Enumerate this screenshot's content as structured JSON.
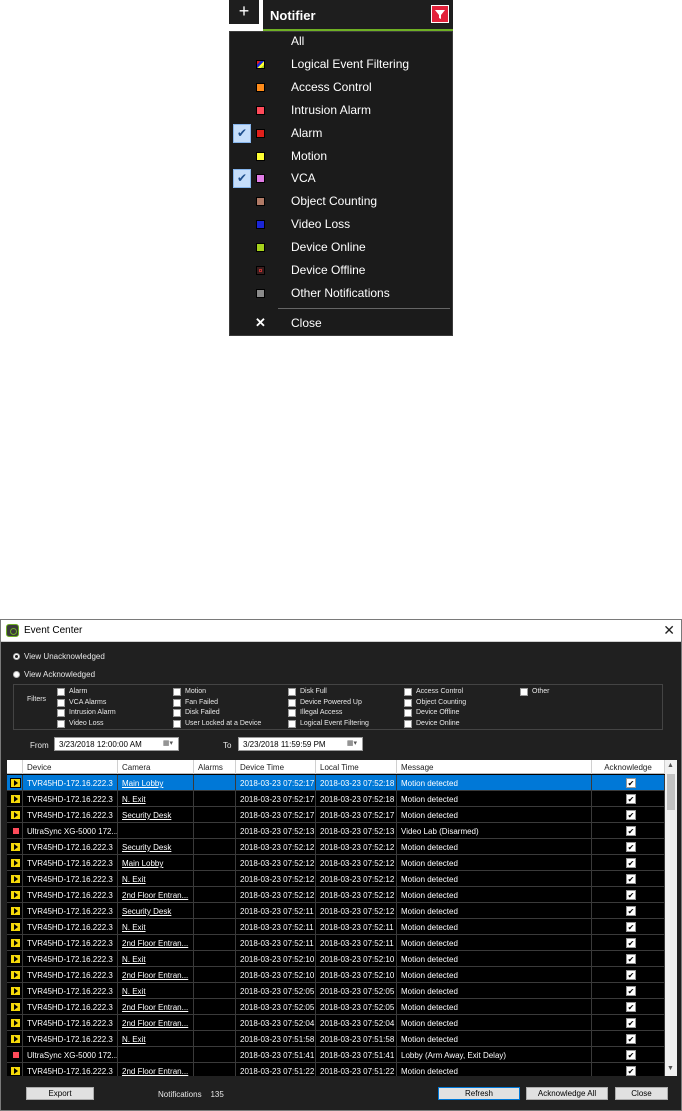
{
  "notifier": {
    "plus_label": "+",
    "title": "Notifier",
    "filter_icon": "filter-funnel-icon",
    "items": [
      {
        "label": "All",
        "color": "",
        "checked": false
      },
      {
        "label": "Logical Event Filtering",
        "color": "multicolor",
        "checked": false
      },
      {
        "label": "Access Control",
        "color": "#ff8c1a",
        "checked": false
      },
      {
        "label": "Intrusion Alarm",
        "color": "#ff4b5a",
        "checked": false
      },
      {
        "label": "Alarm",
        "color": "#e0201b",
        "checked": true
      },
      {
        "label": "Motion",
        "color": "#ffff33",
        "checked": false
      },
      {
        "label": "VCA",
        "color": "#e17ce6",
        "checked": true
      },
      {
        "label": "Object Counting",
        "color": "#b07a66",
        "checked": false
      },
      {
        "label": "Video Loss",
        "color": "#1a25d6",
        "checked": false
      },
      {
        "label": "Device Online",
        "color": "#a6d21c",
        "checked": false
      },
      {
        "label": "Device Offline",
        "color": "#3a1e1e",
        "checked": false
      },
      {
        "label": "Other Notifications",
        "color": "#8a8a8a",
        "checked": false
      }
    ],
    "close_label": "Close",
    "check_mark": "✔"
  },
  "event_center": {
    "title": "Event Center",
    "close_glyph": "✕",
    "view_unacknowledged": "View Unacknowledged",
    "view_acknowledged": "View Acknowledged",
    "filters_label": "Filters",
    "filters": [
      [
        "Alarm",
        "VCA Alarms",
        "Intrusion Alarm",
        "Video Loss"
      ],
      [
        "Motion",
        "Fan Failed",
        "Disk Failed",
        "User Locked at a Device"
      ],
      [
        "Disk Full",
        "Device Powered Up",
        "Illegal Access",
        "Logical Event Filtering"
      ],
      [
        "Access Control",
        "Object Counting",
        "Device Offline",
        "Device Online"
      ],
      [
        "Other"
      ]
    ],
    "from_label": "From",
    "from_value": "3/23/2018 12:00:00 AM",
    "to_label": "To",
    "to_value": "3/23/2018 11:59:59 PM",
    "columns": [
      "Device",
      "Camera",
      "Alarms",
      "Device Time",
      "Local Time",
      "Message",
      "Acknowledge"
    ],
    "rows": [
      {
        "type": "cam",
        "device": "TVR45HD-172.16.222.3",
        "camera": "Main Lobby",
        "alarms": "",
        "device_time": "2018-03-23 07:52:17",
        "local_time": "2018-03-23 07:52:18",
        "message": "Motion detected",
        "ack": true,
        "selected": true
      },
      {
        "type": "cam",
        "device": "TVR45HD-172.16.222.3",
        "camera": "N. Exit",
        "alarms": "",
        "device_time": "2018-03-23 07:52:17",
        "local_time": "2018-03-23 07:52:18",
        "message": "Motion detected",
        "ack": true
      },
      {
        "type": "cam",
        "device": "TVR45HD-172.16.222.3",
        "camera": "Security Desk",
        "alarms": "",
        "device_time": "2018-03-23 07:52:17",
        "local_time": "2018-03-23 07:52:17",
        "message": "Motion detected",
        "ack": true
      },
      {
        "type": "intr",
        "device": "UltraSync XG-5000 172...",
        "camera": "",
        "alarms": "",
        "device_time": "2018-03-23 07:52:13",
        "local_time": "2018-03-23 07:52:13",
        "message": "Video Lab (Disarmed)",
        "ack": true
      },
      {
        "type": "cam",
        "device": "TVR45HD-172.16.222.3",
        "camera": "Security Desk",
        "alarms": "",
        "device_time": "2018-03-23 07:52:12",
        "local_time": "2018-03-23 07:52:12",
        "message": "Motion detected",
        "ack": true
      },
      {
        "type": "cam",
        "device": "TVR45HD-172.16.222.3",
        "camera": "Main Lobby",
        "alarms": "",
        "device_time": "2018-03-23 07:52:12",
        "local_time": "2018-03-23 07:52:12",
        "message": "Motion detected",
        "ack": true
      },
      {
        "type": "cam",
        "device": "TVR45HD-172.16.222.3",
        "camera": "N. Exit",
        "alarms": "",
        "device_time": "2018-03-23 07:52:12",
        "local_time": "2018-03-23 07:52:12",
        "message": "Motion detected",
        "ack": true
      },
      {
        "type": "cam",
        "device": "TVR45HD-172.16.222.3",
        "camera": "2nd Floor Entran...",
        "alarms": "",
        "device_time": "2018-03-23 07:52:12",
        "local_time": "2018-03-23 07:52:12",
        "message": "Motion detected",
        "ack": true
      },
      {
        "type": "cam",
        "device": "TVR45HD-172.16.222.3",
        "camera": "Security Desk",
        "alarms": "",
        "device_time": "2018-03-23 07:52:11",
        "local_time": "2018-03-23 07:52:12",
        "message": "Motion detected",
        "ack": true
      },
      {
        "type": "cam",
        "device": "TVR45HD-172.16.222.3",
        "camera": "N. Exit",
        "alarms": "",
        "device_time": "2018-03-23 07:52:11",
        "local_time": "2018-03-23 07:52:11",
        "message": "Motion detected",
        "ack": true
      },
      {
        "type": "cam",
        "device": "TVR45HD-172.16.222.3",
        "camera": "2nd Floor Entran...",
        "alarms": "",
        "device_time": "2018-03-23 07:52:11",
        "local_time": "2018-03-23 07:52:11",
        "message": "Motion detected",
        "ack": true
      },
      {
        "type": "cam",
        "device": "TVR45HD-172.16.222.3",
        "camera": "N. Exit",
        "alarms": "",
        "device_time": "2018-03-23 07:52:10",
        "local_time": "2018-03-23 07:52:10",
        "message": "Motion detected",
        "ack": true
      },
      {
        "type": "cam",
        "device": "TVR45HD-172.16.222.3",
        "camera": "2nd Floor Entran...",
        "alarms": "",
        "device_time": "2018-03-23 07:52:10",
        "local_time": "2018-03-23 07:52:10",
        "message": "Motion detected",
        "ack": true
      },
      {
        "type": "cam",
        "device": "TVR45HD-172.16.222.3",
        "camera": "N. Exit",
        "alarms": "",
        "device_time": "2018-03-23 07:52:05",
        "local_time": "2018-03-23 07:52:05",
        "message": "Motion detected",
        "ack": true
      },
      {
        "type": "cam",
        "device": "TVR45HD-172.16.222.3",
        "camera": "2nd Floor Entran...",
        "alarms": "",
        "device_time": "2018-03-23 07:52:05",
        "local_time": "2018-03-23 07:52:05",
        "message": "Motion detected",
        "ack": true
      },
      {
        "type": "cam",
        "device": "TVR45HD-172.16.222.3",
        "camera": "2nd Floor Entran...",
        "alarms": "",
        "device_time": "2018-03-23 07:52:04",
        "local_time": "2018-03-23 07:52:04",
        "message": "Motion detected",
        "ack": true
      },
      {
        "type": "cam",
        "device": "TVR45HD-172.16.222.3",
        "camera": "N. Exit",
        "alarms": "",
        "device_time": "2018-03-23 07:51:58",
        "local_time": "2018-03-23 07:51:58",
        "message": "Motion detected",
        "ack": true
      },
      {
        "type": "intr",
        "device": "UltraSync XG-5000 172...",
        "camera": "",
        "alarms": "",
        "device_time": "2018-03-23 07:51:41",
        "local_time": "2018-03-23 07:51:41",
        "message": "Lobby (Arm Away, Exit Delay)",
        "ack": true
      },
      {
        "type": "cam",
        "device": "TVR45HD-172.16.222.3",
        "camera": "2nd Floor Entran...",
        "alarms": "",
        "device_time": "2018-03-23 07:51:22",
        "local_time": "2018-03-23 07:51:22",
        "message": "Motion detected",
        "ack": true
      }
    ],
    "export_label": "Export",
    "notifications_label": "Notifications",
    "notifications_count": "135",
    "refresh_label": "Refresh",
    "ack_all_label": "Acknowledge All",
    "close_label": "Close"
  }
}
